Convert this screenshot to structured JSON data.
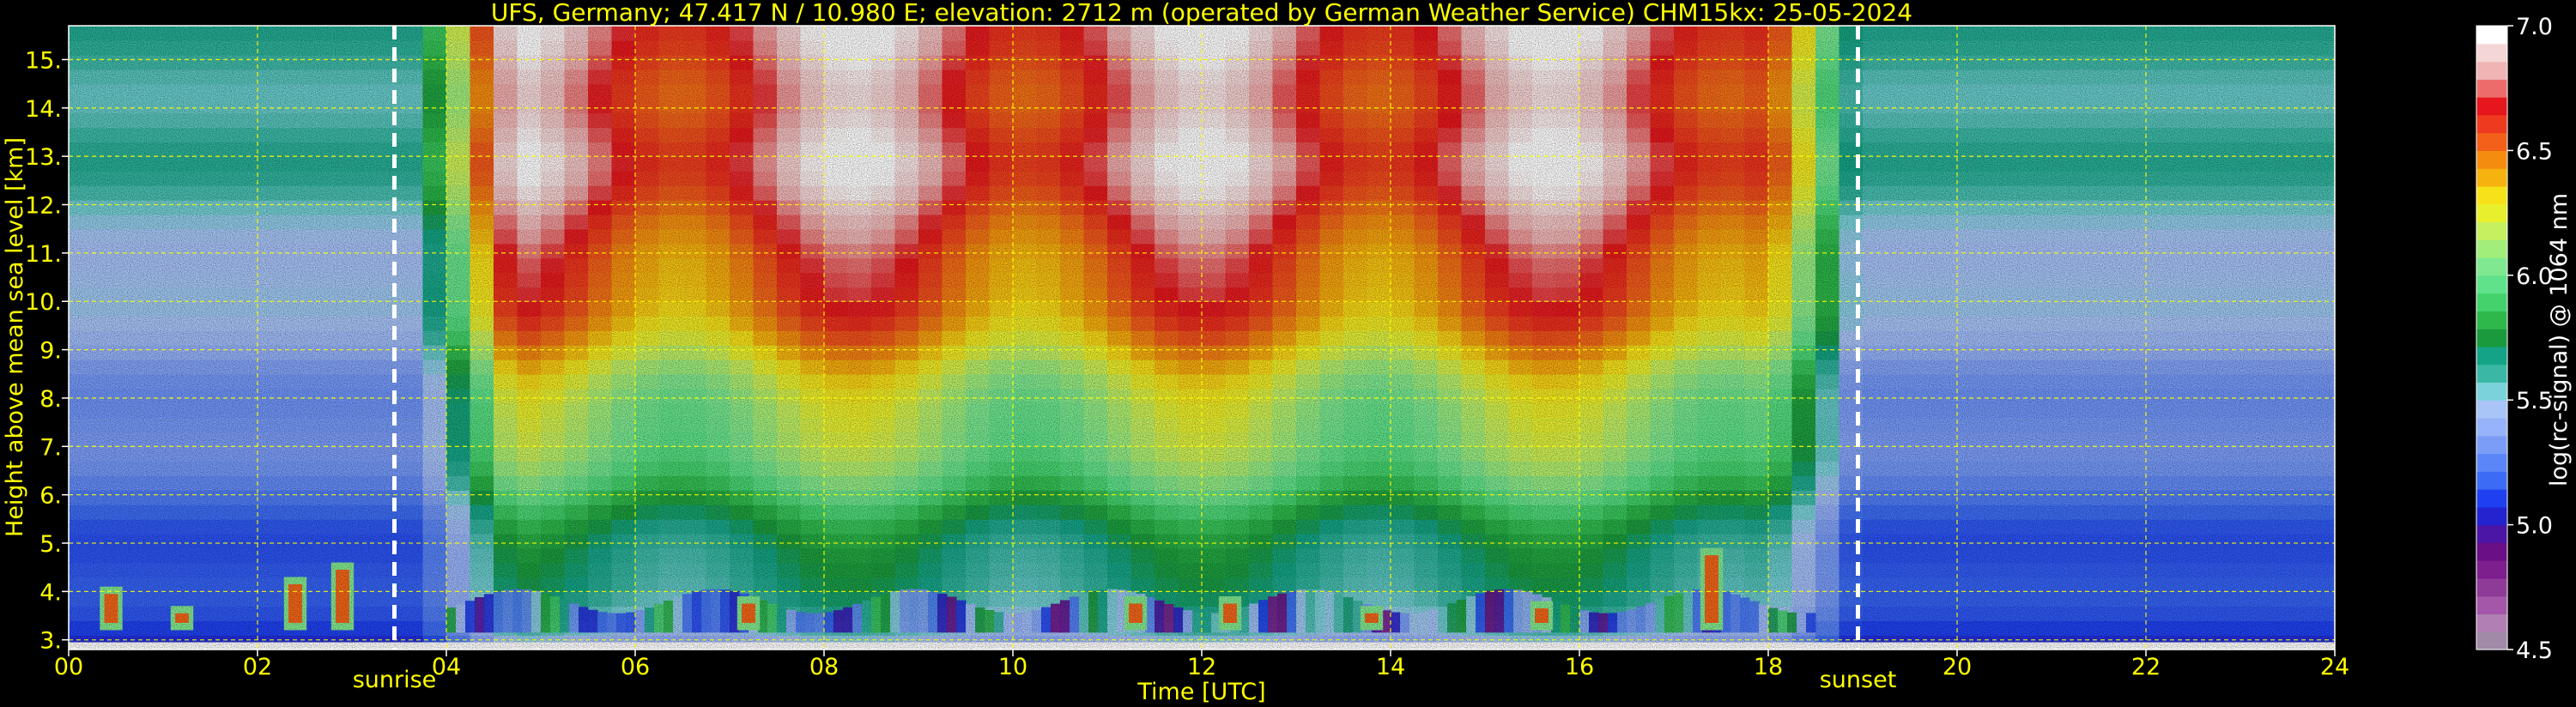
{
  "chart_data": {
    "type": "heatmap",
    "title": "UFS, Germany; 47.417 N / 10.980 E; elevation: 2712 m  (operated by German Weather Service)    CHM15kx: 25-05-2024",
    "xlabel": "Time [UTC]",
    "ylabel": "Height above mean sea level [km]",
    "xlim": [
      0,
      24
    ],
    "ylim": [
      2.8,
      15.7
    ],
    "x_ticks": [
      "00",
      "02",
      "04",
      "06",
      "08",
      "10",
      "12",
      "14",
      "16",
      "18",
      "20",
      "22",
      "24"
    ],
    "x_tick_values": [
      0,
      2,
      4,
      6,
      8,
      10,
      12,
      14,
      16,
      18,
      20,
      22,
      24
    ],
    "y_ticks": [
      "3.",
      "4.",
      "5.",
      "6.",
      "7.",
      "8.",
      "9.",
      "10.",
      "11.",
      "12.",
      "13.",
      "14.",
      "15."
    ],
    "y_tick_values": [
      3,
      4,
      5,
      6,
      7,
      8,
      9,
      10,
      11,
      12,
      13,
      14,
      15
    ],
    "grid": true,
    "annotations": [
      {
        "label": "sunrise",
        "x": 3.45
      },
      {
        "label": "sunset",
        "x": 18.95
      }
    ],
    "colorbar": {
      "label": "log(rc-signal) @ 1064 nm",
      "range": [
        4.5,
        7.0
      ],
      "ticks": [
        "4.5",
        "5.0",
        "5.5",
        "6.0",
        "6.5",
        "7.0"
      ],
      "tick_values": [
        4.5,
        5.0,
        5.5,
        6.0,
        6.5,
        7.0
      ],
      "colors": [
        "#a08aa8",
        "#b17fb3",
        "#a456a8",
        "#8e3a97",
        "#7e1f8e",
        "#6a0f86",
        "#4b15a6",
        "#2323cf",
        "#1e40f0",
        "#3c6cf5",
        "#5b86f7",
        "#7b9df8",
        "#97b3f9",
        "#a9c4f7",
        "#7cd2da",
        "#3bb8a5",
        "#14a386",
        "#1a9a3c",
        "#2eb84a",
        "#44d26d",
        "#5fe28a",
        "#7fe890",
        "#a2ee7a",
        "#c6f060",
        "#e8f02e",
        "#f7e219",
        "#f6b20e",
        "#f48c10",
        "#f2601a",
        "#ee3a1e",
        "#e5171c",
        "#ec6c6c",
        "#f0b4b4",
        "#f5d6d6",
        "#ffffff"
      ]
    },
    "features": {
      "boundary_layer_top_km": 3.8,
      "cloud_events": [
        {
          "t": 0.45,
          "h": 4.1
        },
        {
          "t": 1.2,
          "h": 3.7
        },
        {
          "t": 2.4,
          "h": 4.3
        },
        {
          "t": 2.9,
          "h": 4.6
        },
        {
          "t": 7.2,
          "h": 3.9
        },
        {
          "t": 11.3,
          "h": 3.9
        },
        {
          "t": 12.3,
          "h": 3.9
        },
        {
          "t": 13.8,
          "h": 3.7
        },
        {
          "t": 15.6,
          "h": 3.8
        },
        {
          "t": 17.4,
          "h": 4.9
        }
      ]
    }
  }
}
